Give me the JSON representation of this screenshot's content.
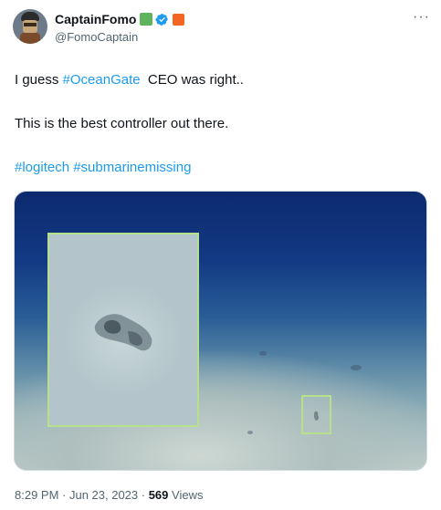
{
  "author": {
    "display_name": "CaptainFomo",
    "handle": "@FomoCaptain",
    "badge_colors": [
      "#5fb35c",
      "#1d9bf0",
      "#f26522"
    ]
  },
  "tweet": {
    "line1_prefix": "I guess ",
    "line1_hashtag": "#OceanGate",
    "line1_suffix": "  CEO was right..",
    "line2": "This is the best controller out there.",
    "hashtags": [
      "#logitech",
      "#submarinemissing"
    ]
  },
  "meta": {
    "timestamp": "8:29 PM · Jun 23, 2023 · ",
    "views_count": "569",
    "views_label": " Views"
  },
  "colors": {
    "link": "#1d9bf0",
    "highlight_box": "#b6e08a"
  },
  "icons": {
    "more": "more-icon",
    "verified": "verified-badge-icon"
  }
}
